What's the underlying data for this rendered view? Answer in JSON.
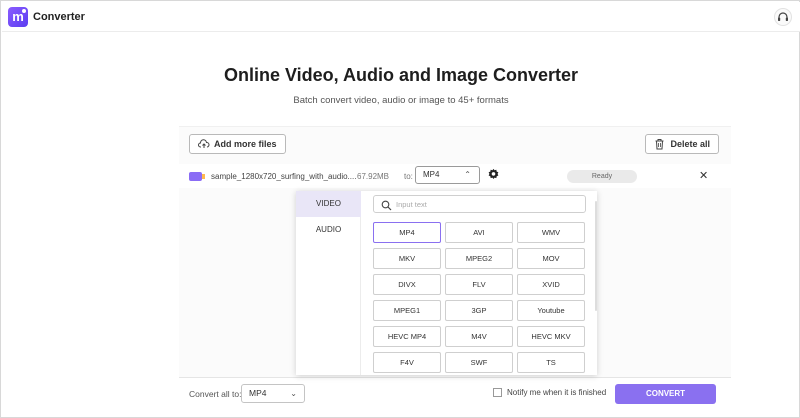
{
  "app": {
    "name": "Converter"
  },
  "hero": {
    "title": "Online Video, Audio and Image Converter",
    "subtitle": "Batch convert video, audio or image to 45+ formats"
  },
  "toolbar": {
    "add_files_label": "Add more files",
    "delete_all_label": "Delete all"
  },
  "file": {
    "name": "sample_1280x720_surfing_with_audio....",
    "size": "67.92MB",
    "to_label": "to:",
    "format": "MP4",
    "status": "Ready"
  },
  "dropdown": {
    "categories": [
      "VIDEO",
      "AUDIO"
    ],
    "active_category": "VIDEO",
    "search_placeholder": "Input text",
    "formats": [
      "MP4",
      "AVI",
      "WMV",
      "MKV",
      "MPEG2",
      "MOV",
      "DIVX",
      "FLV",
      "XVID",
      "MPEG1",
      "3GP",
      "Youtube",
      "HEVC MP4",
      "M4V",
      "HEVC MKV",
      "F4V",
      "SWF",
      "TS"
    ],
    "selected_format": "MP4"
  },
  "bottom_bar": {
    "convert_all_label": "Convert all to:",
    "convert_all_value": "MP4",
    "notify_label": "Notify me when it is finished",
    "convert_label": "CONVERT"
  },
  "colors": {
    "accent": "#8a70f0",
    "brand": "#5b3df0"
  },
  "icons": {
    "logo": "app-logo",
    "support": "headset-icon",
    "add_files": "cloud-upload-icon",
    "delete": "trash-icon",
    "settings": "gear-icon",
    "close": "close-icon",
    "search": "search-icon"
  }
}
